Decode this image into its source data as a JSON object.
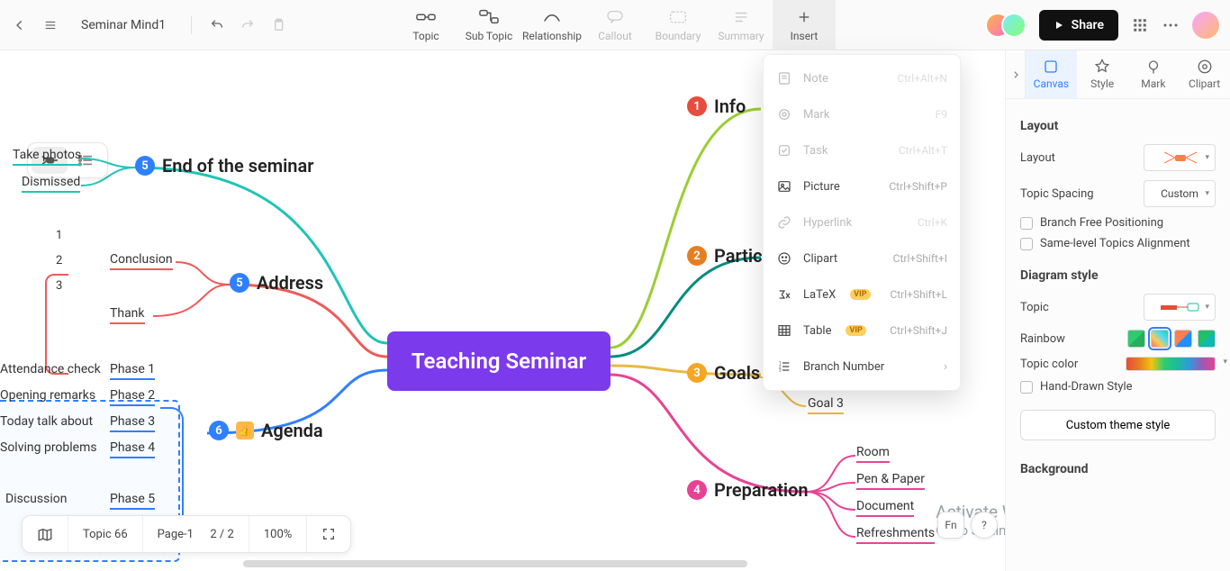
{
  "header": {
    "doc_title": "Seminar Mind1",
    "tools": {
      "topic": "Topic",
      "subtopic": "Sub Topic",
      "relationship": "Relationship",
      "callout": "Callout",
      "boundary": "Boundary",
      "summary": "Summary",
      "insert": "Insert"
    },
    "share": "Share"
  },
  "insert_menu": {
    "note": {
      "label": "Note",
      "shortcut": "Ctrl+Alt+N"
    },
    "mark": {
      "label": "Mark",
      "shortcut": "F9"
    },
    "task": {
      "label": "Task",
      "shortcut": "Ctrl+Alt+T"
    },
    "picture": {
      "label": "Picture",
      "shortcut": "Ctrl+Shift+P"
    },
    "hyper": {
      "label": "Hyperlink",
      "shortcut": "Ctrl+K"
    },
    "clipart": {
      "label": "Clipart",
      "shortcut": "Ctrl+Shift+I"
    },
    "latex": {
      "label": "LaTeX",
      "shortcut": "Ctrl+Shift+L",
      "vip": "VIP"
    },
    "table": {
      "label": "Table",
      "shortcut": "Ctrl+Shift+J",
      "vip": "VIP"
    },
    "branchno": {
      "label": "Branch Number"
    }
  },
  "side": {
    "tabs": {
      "canvas": "Canvas",
      "style": "Style",
      "mark": "Mark",
      "clipart": "Clipart"
    },
    "layout_h": "Layout",
    "layout_label": "Layout",
    "spacing_label": "Topic Spacing",
    "spacing_value": "Custom",
    "branch_free": "Branch Free Positioning",
    "same_level": "Same-level Topics Alignment",
    "diagram_h": "Diagram style",
    "topic_label": "Topic",
    "rainbow_label": "Rainbow",
    "topic_color_label": "Topic color",
    "hand_drawn": "Hand-Drawn Style",
    "custom_theme_btn": "Custom theme style",
    "background_h": "Background"
  },
  "map": {
    "root": "Teaching Seminar",
    "right": {
      "info": "Info",
      "participants": "Participants",
      "goals": "Goals",
      "goal3": "Goal 3",
      "preparation": "Preparation",
      "prep_items": [
        "Room",
        "Pen & Paper",
        "Document",
        "Refreshments"
      ]
    },
    "left": {
      "end": "End of the seminar",
      "end_items": [
        "Take photos",
        "Dismissed"
      ],
      "address": "Address",
      "address_sub": {
        "conclusion": "Conclusion",
        "nums": [
          "1",
          "2",
          "3"
        ],
        "thank": "Thank"
      },
      "agenda": "Agenda",
      "agenda_phases": [
        "Phase 1",
        "Phase 2",
        "Phase 3",
        "Phase 4",
        "Phase 5"
      ],
      "agenda_items": [
        "Attendance check",
        "Opening remarks",
        "Today talk about",
        "Solving problems",
        "",
        "Discussion"
      ]
    }
  },
  "status": {
    "topic_count": "Topic 66",
    "page": "Page-1",
    "page_of": "2 / 2",
    "zoom": "100%"
  },
  "floating": {
    "fn": "Fn",
    "help": "?"
  },
  "watermark": {
    "title": "Activate Windows",
    "sub": "Go to Settings to activate Windows."
  }
}
